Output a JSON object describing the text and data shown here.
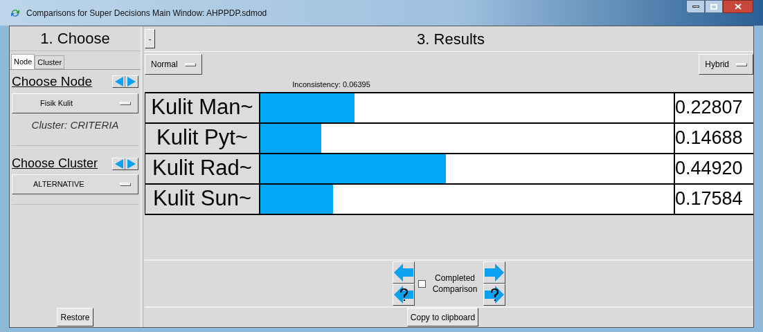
{
  "window": {
    "title": "Comparisons for Super Decisions Main Window: AHPPDP.sdmod"
  },
  "choose": {
    "heading": "1. Choose",
    "tabs": [
      {
        "label": "Node",
        "selected": true
      },
      {
        "label": "Cluster",
        "selected": false
      }
    ],
    "node_label": "Choose Node",
    "node_value": "Fisik Kulit",
    "cluster_note": "Cluster: CRITERIA",
    "cluster_label": "Choose Cluster",
    "cluster_value": "ALTERNATIVE",
    "restore": "Restore"
  },
  "results": {
    "collapse": "-",
    "heading": "3. Results",
    "mode": "Normal",
    "method": "Hybrid",
    "inconsistency": "Inconsistency: 0.06395",
    "rows": [
      {
        "name": "Kulit Man~",
        "level": 0.22807,
        "value": "0.22807"
      },
      {
        "name": "Kulit Pyt~",
        "level": 0.14688,
        "value": "0.14688"
      },
      {
        "name": "Kulit Rad~",
        "level": 0.4492,
        "value": "0.44920"
      },
      {
        "name": "Kulit Sun~",
        "level": 0.17584,
        "value": "0.17584"
      }
    ],
    "completed": {
      "label": "Completed Comparison",
      "checked": false
    },
    "copy": "Copy to clipboard"
  }
}
